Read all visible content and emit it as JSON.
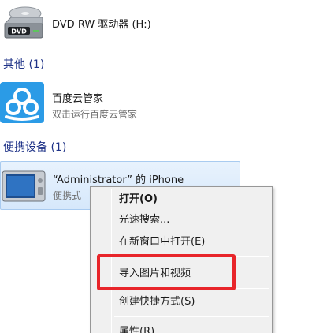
{
  "drives": {
    "dvd": {
      "label": "DVD RW 驱动器 (H:)",
      "icon": "dvd-drive-icon",
      "badge": "DVD"
    }
  },
  "groups": {
    "other": {
      "title": "其他 (1)"
    },
    "portable": {
      "title": "便携设备 (1)"
    }
  },
  "baidu": {
    "name": "百度云管家",
    "description": "双击运行百度云管家",
    "icon": "baidu-cloud-icon",
    "color": "#2b9be6"
  },
  "iphone": {
    "name": "“Administrator” 的 iPhone",
    "description": "便携式",
    "icon": "portable-device-icon"
  },
  "context_menu": {
    "items": [
      {
        "label": "打开(O)",
        "bold": true
      },
      {
        "label": "光速搜索..."
      },
      {
        "label": "在新窗口中打开(E)"
      },
      {
        "label": "导入图片和视频",
        "highlighted": true
      },
      {
        "label": "创建快捷方式(S)"
      },
      {
        "label": "属性(R)"
      }
    ]
  },
  "colors": {
    "group_title": "#1e3287",
    "selection_bg": "#d6e8fb",
    "highlight_border": "#e8252a",
    "menu_bg": "#f0f0f0"
  }
}
